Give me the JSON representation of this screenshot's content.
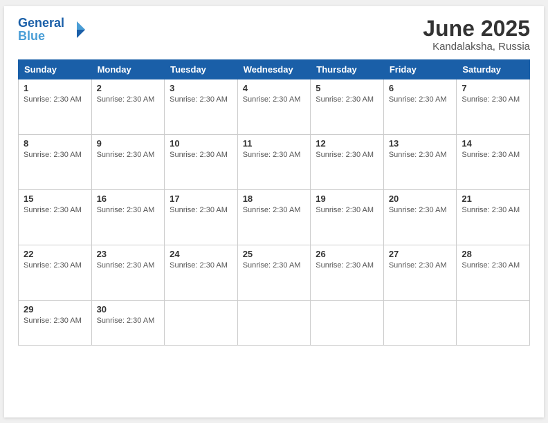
{
  "logo": {
    "line1": "General",
    "line2": "Blue"
  },
  "title": "June 2025",
  "subtitle": "Kandalaksha, Russia",
  "days_of_week": [
    "Sunday",
    "Monday",
    "Tuesday",
    "Wednesday",
    "Thursday",
    "Friday",
    "Saturday"
  ],
  "sunrise_text": "Sunrise: 2:30 AM",
  "weeks": [
    [
      {
        "day": "1",
        "info": "Sunrise: 2:30 AM"
      },
      {
        "day": "2",
        "info": "Sunrise: 2:30 AM"
      },
      {
        "day": "3",
        "info": "Sunrise: 2:30 AM"
      },
      {
        "day": "4",
        "info": "Sunrise: 2:30 AM"
      },
      {
        "day": "5",
        "info": "Sunrise: 2:30 AM"
      },
      {
        "day": "6",
        "info": "Sunrise: 2:30 AM"
      },
      {
        "day": "7",
        "info": "Sunrise: 2:30 AM"
      }
    ],
    [
      {
        "day": "8",
        "info": "Sunrise: 2:30 AM"
      },
      {
        "day": "9",
        "info": "Sunrise: 2:30 AM"
      },
      {
        "day": "10",
        "info": "Sunrise: 2:30 AM"
      },
      {
        "day": "11",
        "info": "Sunrise: 2:30 AM"
      },
      {
        "day": "12",
        "info": "Sunrise: 2:30 AM"
      },
      {
        "day": "13",
        "info": "Sunrise: 2:30 AM"
      },
      {
        "day": "14",
        "info": "Sunrise: 2:30 AM"
      }
    ],
    [
      {
        "day": "15",
        "info": "Sunrise: 2:30 AM"
      },
      {
        "day": "16",
        "info": "Sunrise: 2:30 AM"
      },
      {
        "day": "17",
        "info": "Sunrise: 2:30 AM"
      },
      {
        "day": "18",
        "info": "Sunrise: 2:30 AM"
      },
      {
        "day": "19",
        "info": "Sunrise: 2:30 AM"
      },
      {
        "day": "20",
        "info": "Sunrise: 2:30 AM"
      },
      {
        "day": "21",
        "info": "Sunrise: 2:30 AM"
      }
    ],
    [
      {
        "day": "22",
        "info": "Sunrise: 2:30 AM"
      },
      {
        "day": "23",
        "info": "Sunrise: 2:30 AM"
      },
      {
        "day": "24",
        "info": "Sunrise: 2:30 AM"
      },
      {
        "day": "25",
        "info": "Sunrise: 2:30 AM"
      },
      {
        "day": "26",
        "info": "Sunrise: 2:30 AM"
      },
      {
        "day": "27",
        "info": "Sunrise: 2:30 AM"
      },
      {
        "day": "28",
        "info": "Sunrise: 2:30 AM"
      }
    ],
    [
      {
        "day": "29",
        "info": "Sunrise: 2:30 AM"
      },
      {
        "day": "30",
        "info": "Sunrise: 2:30 AM"
      },
      {
        "day": "",
        "info": ""
      },
      {
        "day": "",
        "info": ""
      },
      {
        "day": "",
        "info": ""
      },
      {
        "day": "",
        "info": ""
      },
      {
        "day": "",
        "info": ""
      }
    ]
  ]
}
